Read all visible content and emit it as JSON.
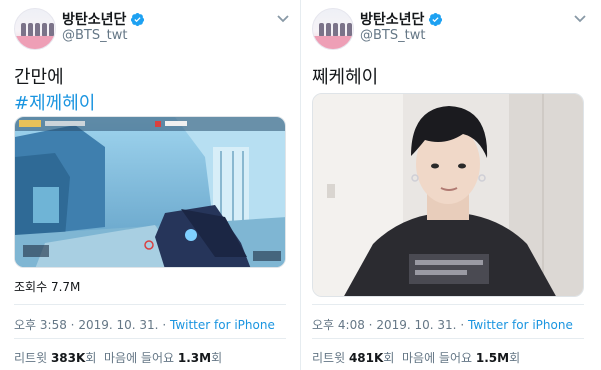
{
  "tweets": [
    {
      "user": {
        "name": "방탄소년단",
        "handle": "@BTS_twt"
      },
      "text": "간만에",
      "hashtag": "#제께헤이",
      "media_type": "game-video",
      "views_label": "조회수",
      "views": "7.7M",
      "time": "오후 3:58",
      "date": "2019. 10. 31.",
      "dot": "·",
      "source": "Twitter for iPhone",
      "retweets_label": "리트윗",
      "retweets": "383K",
      "count_unit": "회",
      "likes_label": "마음에 들어요",
      "likes": "1.3M"
    },
    {
      "user": {
        "name": "방탄소년단",
        "handle": "@BTS_twt"
      },
      "text": "쩨케헤이",
      "media_type": "photo",
      "time": "오후 4:08",
      "date": "2019. 10. 31.",
      "dot": "·",
      "source": "Twitter for iPhone",
      "retweets_label": "리트윗",
      "retweets": "481K",
      "count_unit": "회",
      "likes_label": "마음에 들어요",
      "likes": "1.5M"
    }
  ],
  "colors": {
    "link": "#1b95e0",
    "verified": "#1da1f2",
    "secondary": "#657786",
    "divider": "#e6ecf0"
  },
  "icons": [
    "verified-badge-icon",
    "chevron-down-icon"
  ]
}
